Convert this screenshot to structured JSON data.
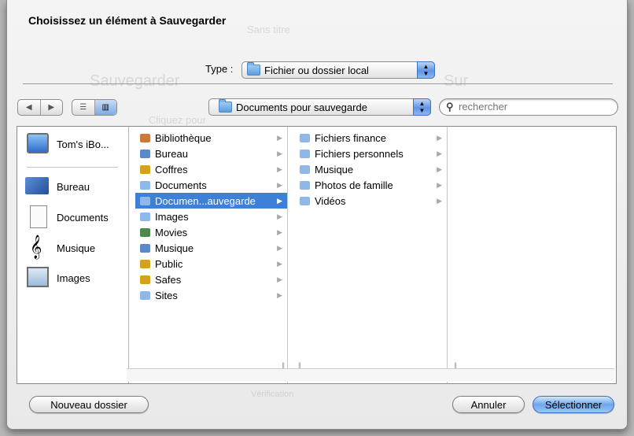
{
  "dialog": {
    "title": "Choisissez un élément à Sauvegarder",
    "type_label": "Type :",
    "type_value": "Fichier ou dossier local",
    "location_value": "Documents pour sauvegarde",
    "search_placeholder": "rechercher"
  },
  "sidebar": {
    "items": [
      {
        "label": "Tom's iBo...",
        "icon": "computer-icon"
      },
      {
        "label": "Bureau",
        "icon": "desktop-icon"
      },
      {
        "label": "Documents",
        "icon": "document-icon"
      },
      {
        "label": "Musique",
        "icon": "music-icon"
      },
      {
        "label": "Images",
        "icon": "images-icon"
      }
    ]
  },
  "columns": {
    "col1": [
      {
        "label": "Bibliothèque",
        "color": "#c77a3a"
      },
      {
        "label": "Bureau",
        "color": "#5b88c8"
      },
      {
        "label": "Coffres",
        "color": "#d4a21c"
      },
      {
        "label": "Documents",
        "color": "#8db8e8"
      },
      {
        "label": "Documen...auvegarde",
        "color": "#8db8e8"
      },
      {
        "label": "Images",
        "color": "#8db8e8"
      },
      {
        "label": "Movies",
        "color": "#4b8a4b"
      },
      {
        "label": "Musique",
        "color": "#5b88c8"
      },
      {
        "label": "Public",
        "color": "#d4a21c"
      },
      {
        "label": "Safes",
        "color": "#d4a21c"
      },
      {
        "label": "Sites",
        "color": "#8db8e8"
      }
    ],
    "col2": [
      {
        "label": "Fichiers finance"
      },
      {
        "label": "Fichiers personnels"
      },
      {
        "label": "Musique"
      },
      {
        "label": "Photos de famille"
      },
      {
        "label": "Vidéos"
      }
    ]
  },
  "buttons": {
    "new_folder": "Nouveau dossier",
    "cancel": "Annuler",
    "select": "Sélectionner"
  },
  "background": {
    "ghost_title": "Sans titre",
    "ghost_save": "Sauvegarder",
    "ghost_on": "Sur",
    "ghost_click": "Cliquez pour",
    "ghost_verify": "Vérification"
  }
}
